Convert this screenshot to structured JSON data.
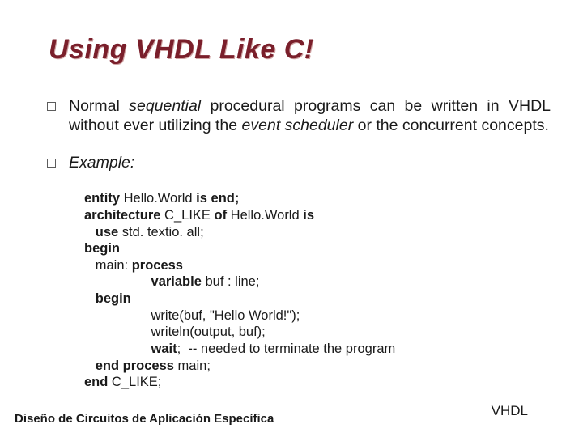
{
  "title": "Using VHDL Like C!",
  "bullets": {
    "seq_normal": "Normal ",
    "seq_sequential": "sequential",
    "seq_rest1": " procedural programs can be written in VHDL without ever utilizing the ",
    "seq_event": "event scheduler",
    "seq_rest2": " or the concurrent concepts.",
    "example": "Example:"
  },
  "code": {
    "l01a": "entity",
    "l01b": " Hello.World ",
    "l01c": "is end;",
    "l02a": "architecture",
    "l02b": " C_LIKE ",
    "l02c": "of",
    "l02d": " Hello.World ",
    "l02e": "is",
    "l03a": "   use",
    "l03b": " std. textio. all;",
    "l04a": "begin",
    "l05a": "   main: ",
    "l05b": "process",
    "l06a": "                  variable",
    "l06b": " buf : line;",
    "l07a": "   begin",
    "l08a": "                  write(buf, \"Hello World!\");",
    "l09a": "                  writeln(output, buf);",
    "l10a": "                  wait",
    "l10b": ";  -- needed to terminate the program",
    "l11a": "   end process",
    "l11b": " main;",
    "l12a": "end",
    "l12b": " C_LIKE;"
  },
  "footer": {
    "left": "Diseño de Circuitos de Aplicación Específica",
    "right": "VHDL"
  }
}
